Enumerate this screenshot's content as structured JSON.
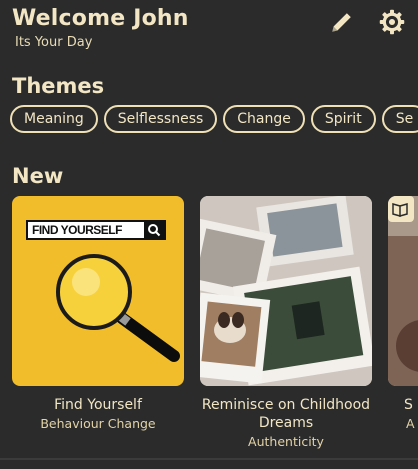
{
  "header": {
    "welcome": "Welcome John",
    "subtitle": "Its Your Day",
    "edit_icon": "pencil-icon",
    "settings_icon": "gear-icon"
  },
  "themes": {
    "title": "Themes",
    "chips": [
      "Meaning",
      "Selflessness",
      "Change",
      "Spirit",
      "Se"
    ]
  },
  "new_section": {
    "title": "New",
    "cards": [
      {
        "title": "Find Yourself",
        "subtitle": "Behaviour Change",
        "image_text": "FIND YOURSELF"
      },
      {
        "title": "Reminisce on Childhood Dreams",
        "subtitle": "Authenticity"
      },
      {
        "title": "S",
        "subtitle": "A"
      }
    ]
  },
  "colors": {
    "background": "#2b2b2b",
    "text": "#f2e6c4",
    "accent_yellow": "#f2bd2b"
  }
}
